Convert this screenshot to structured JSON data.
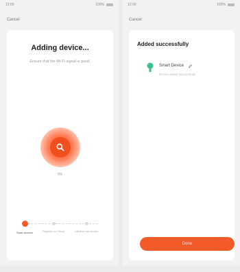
{
  "colors": {
    "accent": "#f25a2a",
    "pulse": "#ff6a3d",
    "device_icon": "#3cc28c"
  },
  "left": {
    "status": {
      "time": "12:00",
      "right": "100%"
    },
    "nav_back": "Cancel",
    "title": "Adding device...",
    "subtitle": "Ensure that the Wi-Fi signal is good.",
    "percent": "0%",
    "icons": {
      "center": "search-icon"
    },
    "steps": [
      {
        "label": "Scan devices"
      },
      {
        "label": "Register on Cloud"
      },
      {
        "label": "Initialize the device"
      }
    ]
  },
  "right": {
    "status": {
      "time": "12:00",
      "right": "100%"
    },
    "nav_back": "Cancel",
    "title": "Added successfully",
    "device": {
      "name": "Smart Device",
      "subtitle": "Device added successfully",
      "icon": "device-icon"
    },
    "done_label": "Done"
  }
}
